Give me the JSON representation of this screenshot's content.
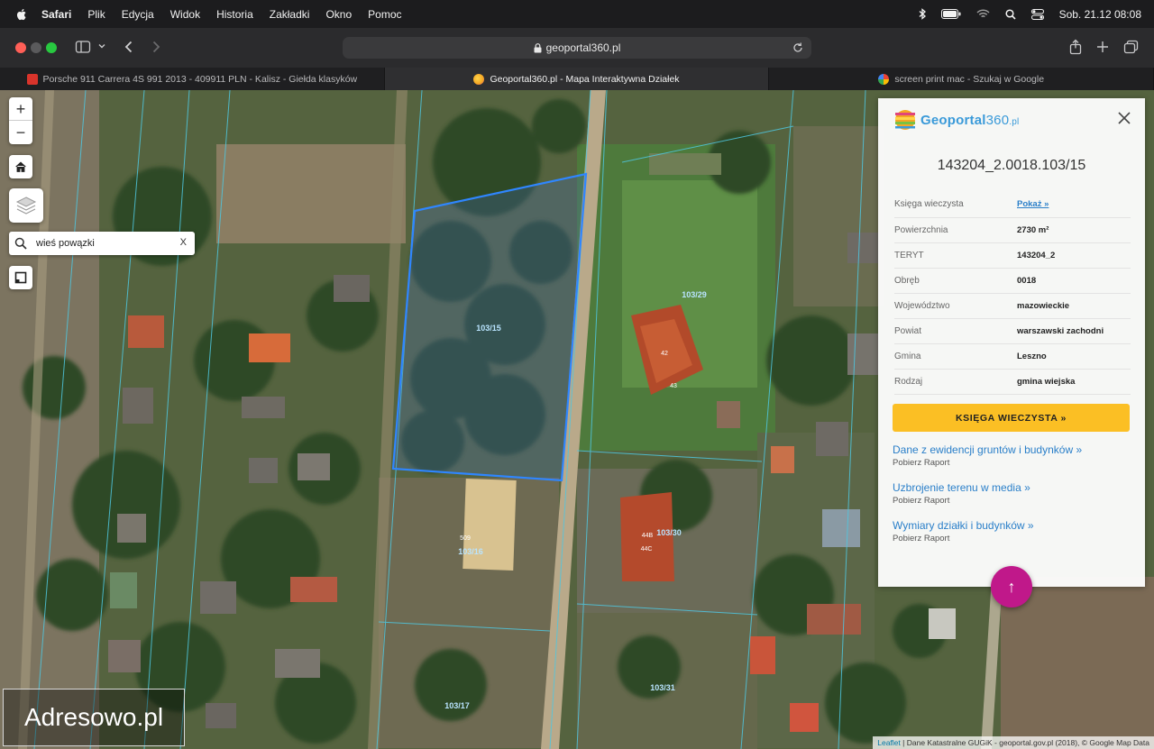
{
  "menubar": {
    "app": "Safari",
    "items": [
      "Plik",
      "Edycja",
      "Widok",
      "Historia",
      "Zakładki",
      "Okno",
      "Pomoc"
    ],
    "clock": "Sob. 21.12  08:08"
  },
  "toolbar": {
    "url": "geoportal360.pl"
  },
  "tabs": [
    {
      "title": "Porsche 911 Carrera 4S 991 2013 - 409911 PLN - Kalisz - Giełda klasyków",
      "active": false,
      "favicon_color": "#d9342b"
    },
    {
      "title": "Geoportal360.pl - Mapa Interaktywna Działek",
      "active": true,
      "favicon_color": "#f5a623"
    },
    {
      "title": "screen print mac - Szukaj w Google",
      "active": false,
      "favicon_color": "#4285f4"
    }
  ],
  "map": {
    "search_value": "wieś powązki",
    "clear_label": "X",
    "zoom_in": "+",
    "zoom_out": "−",
    "parcel_labels": [
      "103/15",
      "103/16",
      "103/29",
      "103/30",
      "103/17",
      "103/31",
      "509"
    ],
    "house_labels": [
      "42",
      "43",
      "44B",
      "44C"
    ],
    "selected_outline_color": "#2f86ff",
    "attribution_link": "Leaflet",
    "attribution_text": "| Dane Katastralne GUGiK - geoportal.gov.pl (2018), © Google Map Data"
  },
  "watermark": "Adresowo.pl",
  "panel": {
    "logo_name": "Geoportal",
    "logo_num": "360",
    "logo_tld": ".pl",
    "parcel_id": "143204_2.0018.103/15",
    "rows": [
      {
        "label": "Księga wieczysta",
        "value": "Pokaż »",
        "link": true
      },
      {
        "label": "Powierzchnia",
        "value": "2730 m²",
        "link": false
      },
      {
        "label": "TERYT",
        "value": "143204_2",
        "link": false
      },
      {
        "label": "Obręb",
        "value": "0018",
        "link": false
      },
      {
        "label": "Województwo",
        "value": "mazowieckie",
        "link": false
      },
      {
        "label": "Powiat",
        "value": "warszawski zachodni",
        "link": false
      },
      {
        "label": "Gmina",
        "value": "Leszno",
        "link": false
      },
      {
        "label": "Rodzaj",
        "value": "gmina wiejska",
        "link": false
      }
    ],
    "kw_button": "KSIĘGA WIECZYSTA »",
    "links": [
      {
        "title": "Dane z ewidencji gruntów i budynków »",
        "sub": "Pobierz Raport"
      },
      {
        "title": "Uzbrojenie terenu w media »",
        "sub": "Pobierz Raport"
      },
      {
        "title": "Wymiary działki i budynków »",
        "sub": "Pobierz Raport"
      }
    ],
    "accent_color": "#fbbf24",
    "link_color": "#2a7fc9"
  },
  "fab": {
    "label": "↑",
    "color": "#c0188a"
  }
}
